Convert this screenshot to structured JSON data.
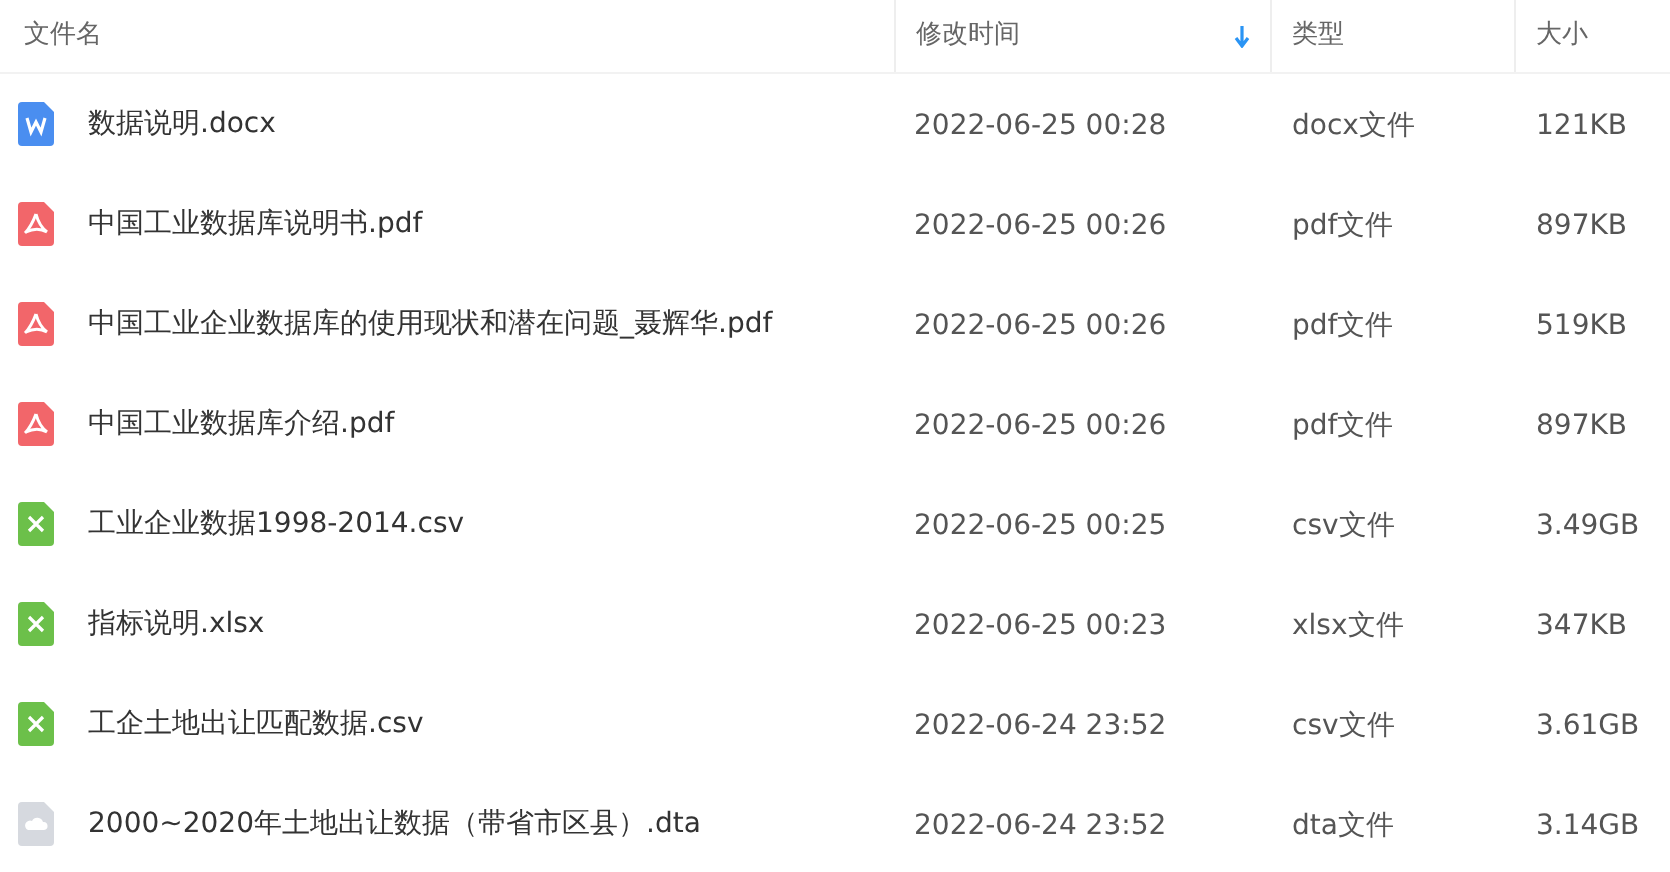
{
  "columns": [
    {
      "label": "文件名",
      "sorted": false
    },
    {
      "label": "修改时间",
      "sorted": true
    },
    {
      "label": "类型",
      "sorted": false
    },
    {
      "label": "大小",
      "sorted": false
    }
  ],
  "rows": [
    {
      "kind": "word",
      "name": "数据说明.docx",
      "modified": "2022-06-25 00:28",
      "type": "docx文件",
      "size": "121KB"
    },
    {
      "kind": "pdf",
      "name": "中国工业数据库说明书.pdf",
      "modified": "2022-06-25 00:26",
      "type": "pdf文件",
      "size": "897KB"
    },
    {
      "kind": "pdf",
      "name": "中国工业企业数据库的使用现状和潜在问题_聂辉华.pdf",
      "modified": "2022-06-25 00:26",
      "type": "pdf文件",
      "size": "519KB"
    },
    {
      "kind": "pdf",
      "name": "中国工业数据库介绍.pdf",
      "modified": "2022-06-25 00:26",
      "type": "pdf文件",
      "size": "897KB"
    },
    {
      "kind": "excel",
      "name": "工业企业数据1998-2014.csv",
      "modified": "2022-06-25 00:25",
      "type": "csv文件",
      "size": "3.49GB"
    },
    {
      "kind": "excel",
      "name": "指标说明.xlsx",
      "modified": "2022-06-25 00:23",
      "type": "xlsx文件",
      "size": "347KB"
    },
    {
      "kind": "excel",
      "name": "工企土地出让匹配数据.csv",
      "modified": "2022-06-24 23:52",
      "type": "csv文件",
      "size": "3.61GB"
    },
    {
      "kind": "cloud",
      "name": "2000~2020年土地出让数据（带省市区县）.dta",
      "modified": "2022-06-24 23:52",
      "type": "dta文件",
      "size": "3.14GB"
    }
  ]
}
